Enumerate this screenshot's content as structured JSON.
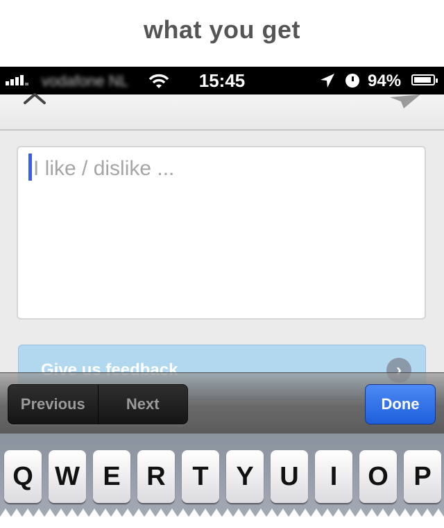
{
  "caption": {
    "text": "what you get"
  },
  "status_bar": {
    "carrier": "vodafone NL",
    "time": "15:45",
    "battery": "94%",
    "battery_level": 0.94
  },
  "nav": {
    "back_icon": "chevron-up-icon",
    "send_icon": "paper-plane-icon"
  },
  "form": {
    "textarea_placeholder": "I like / dislike ...",
    "submit_label": "Give us feedback",
    "submit_icon": "chevron-right-icon"
  },
  "accessory": {
    "previous_label": "Previous",
    "next_label": "Next",
    "done_label": "Done"
  },
  "keyboard": {
    "row1": [
      "Q",
      "W",
      "E",
      "R",
      "T",
      "Y",
      "U",
      "I",
      "O",
      "P"
    ]
  },
  "colors": {
    "accent_blue": "#1e5fdb",
    "cursor": "#3a5ee8",
    "button_bg": "#b2d8f0"
  }
}
